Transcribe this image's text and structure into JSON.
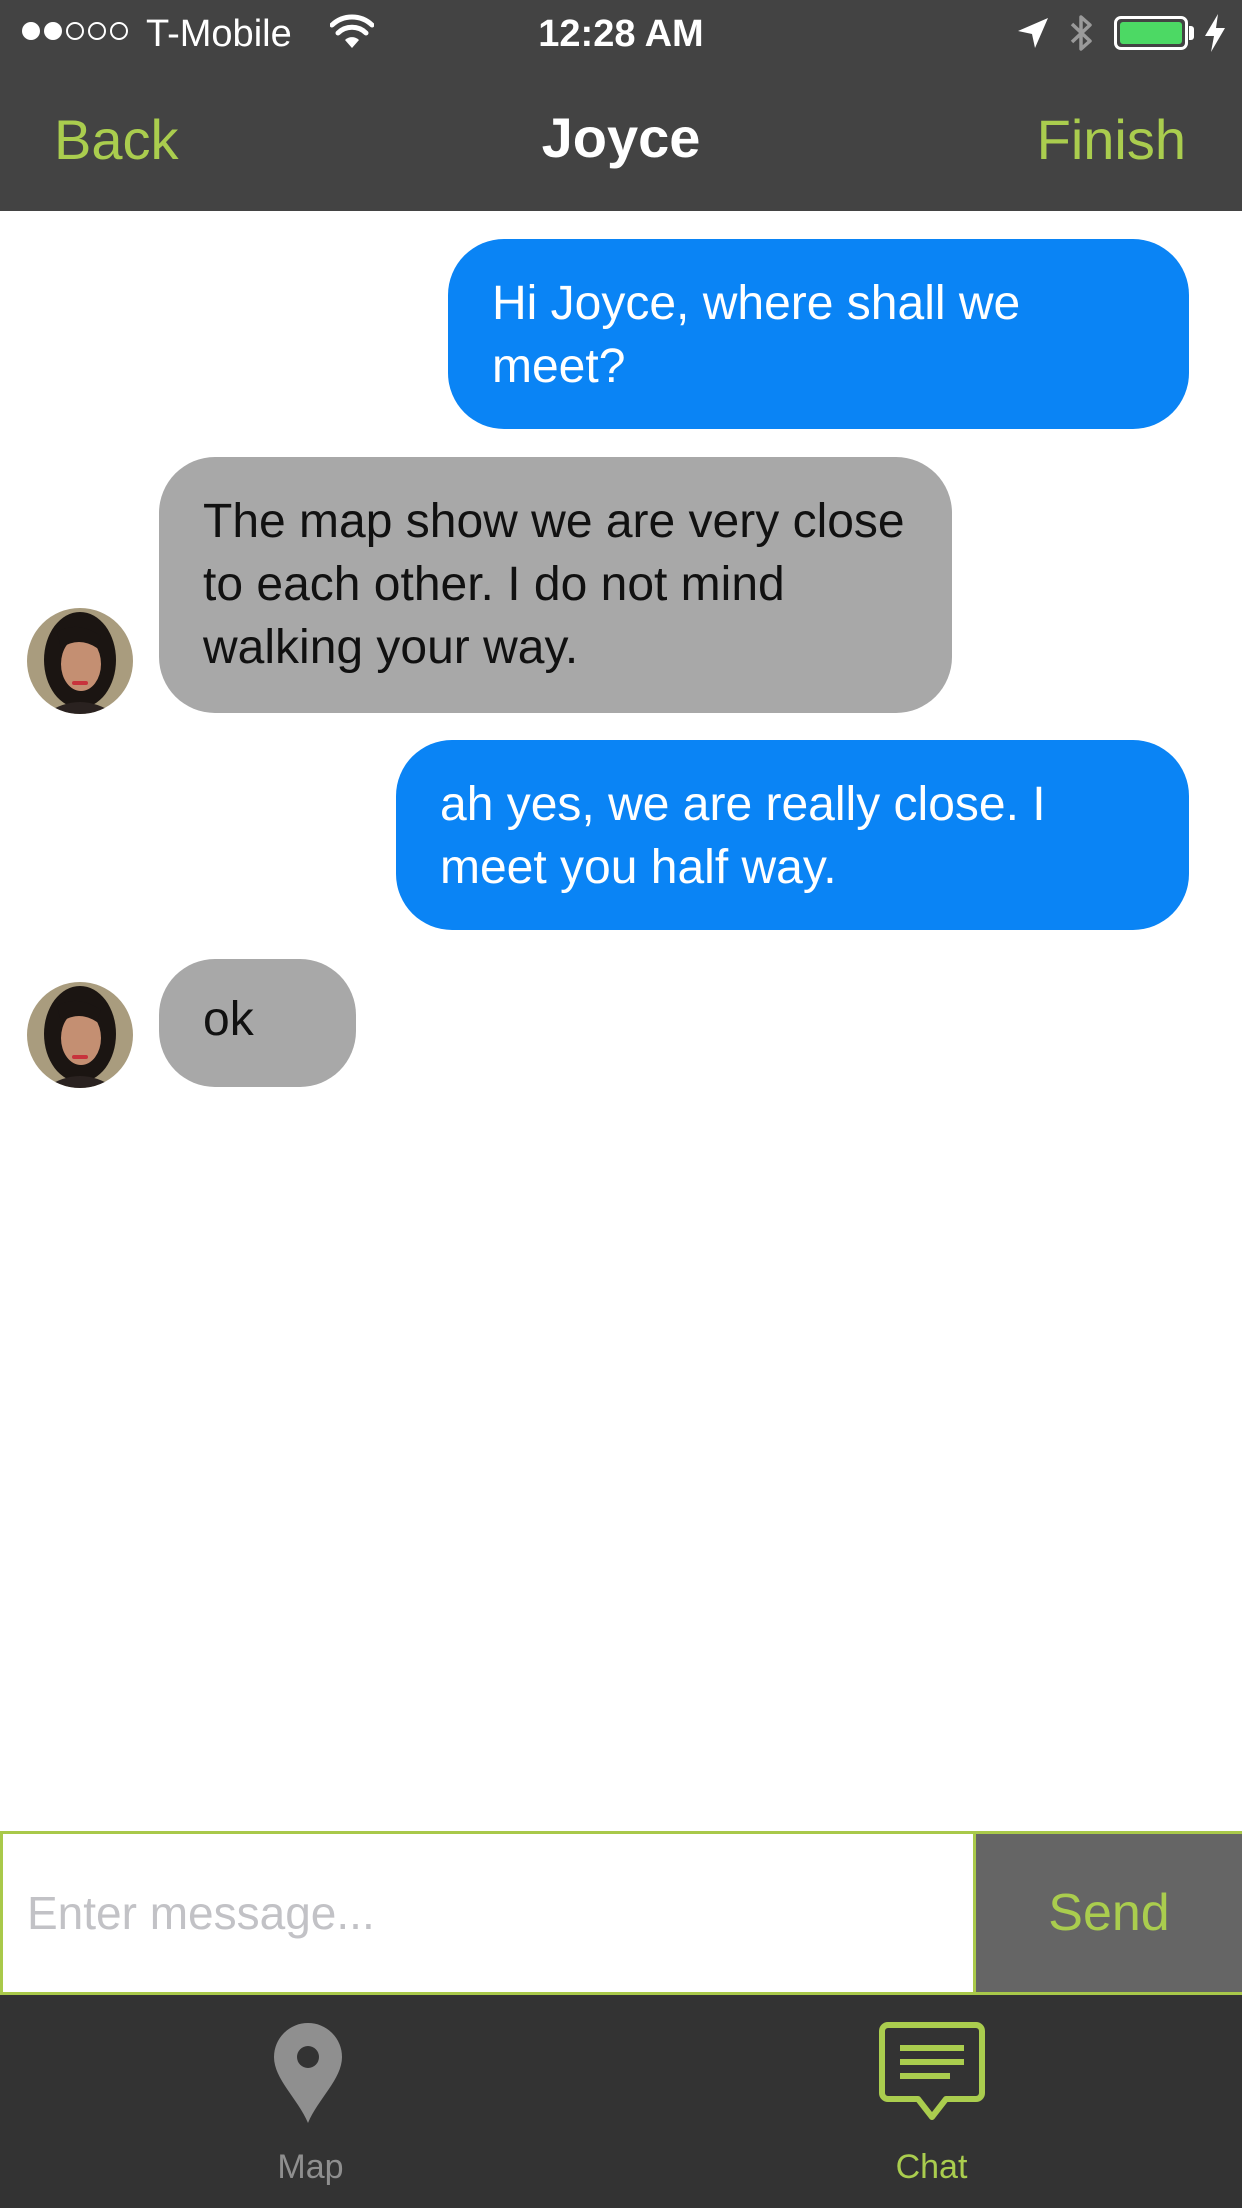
{
  "status_bar": {
    "signal_dots": [
      "full",
      "full",
      "empty",
      "empty",
      "empty"
    ],
    "carrier": "T-Mobile",
    "time": "12:28 AM",
    "battery_level": 1.0,
    "battery_color": "#4cd964",
    "icons": [
      "signal-icon",
      "wifi-icon",
      "location-arrow-icon",
      "bluetooth-icon",
      "battery-icon",
      "charging-bolt-icon"
    ]
  },
  "nav": {
    "back_label": "Back",
    "title": "Joyce",
    "finish_label": "Finish",
    "accent_color": "#aacd4e"
  },
  "messages": [
    {
      "direction": "outgoing",
      "text": "Hi Joyce, where shall we meet?"
    },
    {
      "direction": "incoming",
      "text": "The map show we are very close to each other. I do not mind walking your way."
    },
    {
      "direction": "outgoing",
      "text": "ah yes, we are really close. I meet you half way."
    },
    {
      "direction": "incoming",
      "text": "ok"
    }
  ],
  "composer": {
    "placeholder": "Enter message...",
    "value": "",
    "send_label": "Send"
  },
  "tabs": [
    {
      "label": "Map",
      "icon": "map-pin-icon",
      "selected": false
    },
    {
      "label": "Chat",
      "icon": "chat-icon",
      "selected": true
    }
  ],
  "colors": {
    "outgoing_bubble": "#0a84f5",
    "incoming_bubble": "#a8a8a8",
    "header_background": "#434343",
    "tabbar_background": "#333333"
  }
}
